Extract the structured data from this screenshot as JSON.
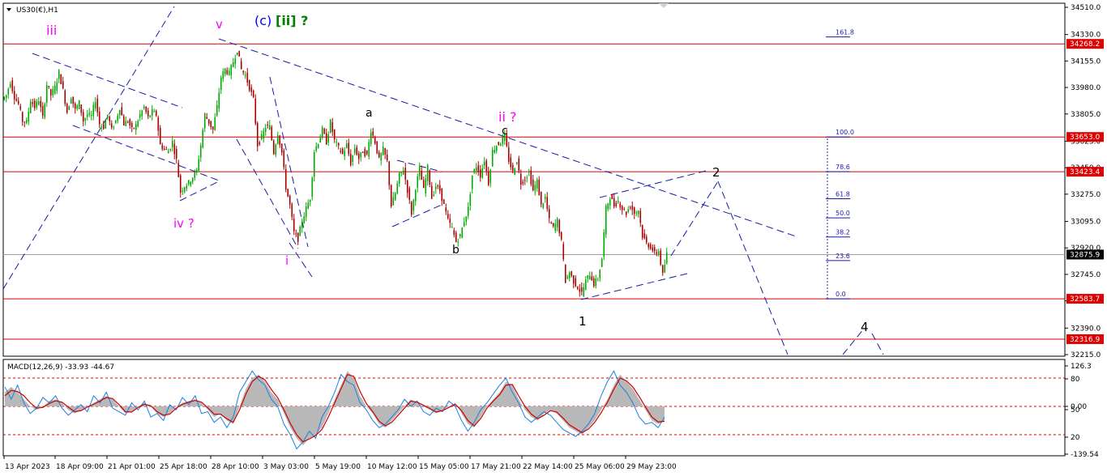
{
  "chart_header": {
    "symbol_label": "US30(€),H1",
    "macd_label": "MACD(12,26,9) -33.93 -44.67"
  },
  "colors": {
    "background": "#ffffff",
    "grid_border": "#000000",
    "bull_candle": "#00aa00",
    "bear_candle": "#aa0000",
    "resistance_line": "#dd0000",
    "trend_line": "#1a1aa8",
    "current_price_line": "#9e9e9e",
    "price_tag": "#dd0000",
    "current_price_tag": "#000000",
    "macd_hist": "#b8b8b8",
    "macd_signal": "#cc0000",
    "macd_line": "#1e7fe0",
    "wave_magenta": "#ff00ff",
    "wave_blue": "#0000ff",
    "wave_green": "#008000",
    "wave_black": "#000000"
  },
  "chart_data": [
    {
      "type": "candlestick",
      "symbol": "US30(€)",
      "timeframe": "H1",
      "ylim": [
        32110,
        34560
      ],
      "y_ticks": [
        34510.0,
        34330.0,
        34155.0,
        33980.0,
        33805.0,
        33625.0,
        33450.0,
        33275.0,
        33095.0,
        32920.0,
        32745.0,
        32570.0,
        32390.0,
        32215.0
      ],
      "x_tick_labels": [
        "13 Apr 2023",
        "18 Apr 09:00",
        "21 Apr 01:00",
        "25 Apr 18:00",
        "28 Apr 10:00",
        "3 May 03:00",
        "5 May 19:00",
        "10 May 12:00",
        "15 May 05:00",
        "17 May 21:00",
        "22 May 14:00",
        "25 May 06:00",
        "29 May 23:00"
      ],
      "horizontal_levels": [
        34268.2,
        33653.0,
        33423.4,
        32583.7,
        32316.9
      ],
      "current_price": 32875.9,
      "price_path": [
        [
          0,
          33900
        ],
        [
          5,
          33930
        ],
        [
          10,
          34020
        ],
        [
          15,
          33920
        ],
        [
          20,
          33870
        ],
        [
          25,
          33760
        ],
        [
          30,
          33750
        ],
        [
          35,
          33900
        ],
        [
          40,
          33850
        ],
        [
          45,
          33900
        ],
        [
          50,
          33780
        ],
        [
          55,
          34000
        ],
        [
          60,
          33930
        ],
        [
          65,
          33980
        ],
        [
          70,
          34080
        ],
        [
          75,
          33960
        ],
        [
          80,
          33820
        ],
        [
          85,
          33920
        ],
        [
          90,
          33830
        ],
        [
          95,
          33880
        ],
        [
          100,
          33760
        ],
        [
          105,
          33800
        ],
        [
          110,
          33790
        ],
        [
          115,
          33900
        ],
        [
          120,
          33740
        ],
        [
          125,
          33720
        ],
        [
          130,
          33800
        ],
        [
          135,
          33700
        ],
        [
          140,
          33760
        ],
        [
          145,
          33850
        ],
        [
          150,
          33740
        ],
        [
          155,
          33760
        ],
        [
          160,
          33700
        ],
        [
          165,
          33730
        ],
        [
          170,
          33800
        ],
        [
          175,
          33850
        ],
        [
          180,
          33780
        ],
        [
          185,
          33820
        ],
        [
          190,
          33800
        ],
        [
          195,
          33600
        ],
        [
          200,
          33570
        ],
        [
          205,
          33560
        ],
        [
          210,
          33620
        ],
        [
          215,
          33500
        ],
        [
          220,
          33290
        ],
        [
          225,
          33330
        ],
        [
          230,
          33350
        ],
        [
          235,
          33390
        ],
        [
          240,
          33430
        ],
        [
          245,
          33600
        ],
        [
          250,
          33800
        ],
        [
          255,
          33750
        ],
        [
          260,
          33700
        ],
        [
          265,
          33850
        ],
        [
          270,
          34050
        ],
        [
          275,
          34100
        ],
        [
          280,
          34070
        ],
        [
          285,
          34150
        ],
        [
          290,
          34230
        ],
        [
          295,
          34100
        ],
        [
          300,
          34060
        ],
        [
          305,
          33980
        ],
        [
          310,
          33900
        ],
        [
          315,
          33600
        ],
        [
          320,
          33650
        ],
        [
          325,
          33720
        ],
        [
          330,
          33720
        ],
        [
          335,
          33550
        ],
        [
          340,
          33680
        ],
        [
          345,
          33550
        ],
        [
          350,
          33320
        ],
        [
          355,
          33200
        ],
        [
          360,
          33020
        ],
        [
          365,
          32980
        ],
        [
          370,
          33100
        ],
        [
          375,
          33180
        ],
        [
          380,
          33250
        ],
        [
          385,
          33560
        ],
        [
          390,
          33620
        ],
        [
          395,
          33700
        ],
        [
          400,
          33620
        ],
        [
          405,
          33750
        ],
        [
          410,
          33630
        ],
        [
          415,
          33580
        ],
        [
          420,
          33540
        ],
        [
          425,
          33600
        ],
        [
          430,
          33480
        ],
        [
          435,
          33580
        ],
        [
          440,
          33510
        ],
        [
          445,
          33560
        ],
        [
          450,
          33530
        ],
        [
          455,
          33700
        ],
        [
          460,
          33620
        ],
        [
          465,
          33500
        ],
        [
          470,
          33570
        ],
        [
          475,
          33490
        ],
        [
          480,
          33200
        ],
        [
          485,
          33280
        ],
        [
          490,
          33400
        ],
        [
          495,
          33440
        ],
        [
          500,
          33300
        ],
        [
          505,
          33150
        ],
        [
          510,
          33320
        ],
        [
          515,
          33440
        ],
        [
          520,
          33300
        ],
        [
          525,
          33450
        ],
        [
          530,
          33250
        ],
        [
          535,
          33330
        ],
        [
          540,
          33300
        ],
        [
          545,
          33200
        ],
        [
          550,
          33100
        ],
        [
          555,
          33050
        ],
        [
          560,
          32960
        ],
        [
          565,
          33000
        ],
        [
          570,
          33100
        ],
        [
          575,
          33180
        ],
        [
          580,
          33400
        ],
        [
          585,
          33460
        ],
        [
          590,
          33400
        ],
        [
          595,
          33500
        ],
        [
          600,
          33350
        ],
        [
          605,
          33560
        ],
        [
          610,
          33600
        ],
        [
          615,
          33620
        ],
        [
          620,
          33660
        ],
        [
          625,
          33500
        ],
        [
          630,
          33420
        ],
        [
          635,
          33500
        ],
        [
          640,
          33350
        ],
        [
          645,
          33380
        ],
        [
          650,
          33420
        ],
        [
          655,
          33300
        ],
        [
          660,
          33360
        ],
        [
          665,
          33200
        ],
        [
          670,
          33250
        ],
        [
          675,
          33100
        ],
        [
          680,
          33050
        ],
        [
          685,
          33100
        ],
        [
          690,
          32960
        ],
        [
          695,
          32700
        ],
        [
          700,
          32760
        ],
        [
          705,
          32700
        ],
        [
          710,
          32660
        ],
        [
          715,
          32620
        ],
        [
          720,
          32700
        ],
        [
          725,
          32750
        ],
        [
          730,
          32680
        ],
        [
          735,
          32720
        ],
        [
          740,
          32850
        ],
        [
          745,
          33180
        ],
        [
          750,
          33260
        ],
        [
          755,
          33200
        ],
        [
          760,
          33230
        ],
        [
          765,
          33180
        ],
        [
          770,
          33150
        ],
        [
          775,
          33200
        ],
        [
          780,
          33150
        ],
        [
          785,
          33170
        ],
        [
          790,
          33000
        ],
        [
          795,
          32950
        ],
        [
          800,
          32930
        ],
        [
          805,
          32880
        ],
        [
          810,
          32900
        ],
        [
          815,
          32740
        ],
        [
          820,
          32880
        ]
      ],
      "fibonacci": {
        "levels": [
          "0.0",
          "23.6",
          "38.2",
          "50.0",
          "61.8",
          "78.6",
          "100.0",
          "161.8"
        ]
      },
      "annotations": [
        {
          "text": "iii",
          "color": "magenta"
        },
        {
          "text": "v",
          "color": "magenta"
        },
        {
          "text": "(c)",
          "color": "blue"
        },
        {
          "text": "[ii] ?",
          "color": "green"
        },
        {
          "text": "iv ?",
          "color": "magenta"
        },
        {
          "text": "i",
          "color": "magenta"
        },
        {
          "text": "a",
          "color": "black"
        },
        {
          "text": "b",
          "color": "black"
        },
        {
          "text": "c",
          "color": "black"
        },
        {
          "text": "ii ?",
          "color": "magenta"
        },
        {
          "text": "1",
          "color": "black"
        },
        {
          "text": "2",
          "color": "black"
        },
        {
          "text": "4",
          "color": "black"
        }
      ]
    },
    {
      "type": "macd",
      "name": "MACD(12,26,9)",
      "y_ticks": [
        "126.3",
        "80",
        "0.00",
        "50",
        "20",
        "-139.54"
      ],
      "dashed_levels": [
        80,
        0,
        -80
      ],
      "histogram": [
        40,
        55,
        40,
        20,
        0,
        -10,
        0,
        15,
        20,
        10,
        -10,
        -20,
        -10,
        0,
        10,
        20,
        30,
        20,
        0,
        -20,
        -15,
        0,
        10,
        0,
        -20,
        -30,
        -20,
        0,
        10,
        15,
        20,
        10,
        -10,
        -30,
        -20,
        -40,
        -50,
        0,
        50,
        80,
        90,
        70,
        40,
        20,
        -20,
        -60,
        -90,
        -110,
        -90,
        -80,
        -60,
        -20,
        20,
        60,
        100,
        80,
        30,
        0,
        -20,
        -50,
        -60,
        -40,
        -20,
        0,
        20,
        10,
        0,
        -10,
        -20,
        -10,
        0,
        10,
        -20,
        -50,
        -60,
        -30,
        0,
        20,
        40,
        70,
        60,
        20,
        -10,
        -30,
        -40,
        -20,
        -10,
        -20,
        -40,
        -60,
        -70,
        -80,
        -60,
        -40,
        -10,
        20,
        60,
        90,
        70,
        50,
        20,
        -10,
        -40,
        -50,
        -40
      ],
      "signal": [
        30,
        45,
        42,
        30,
        10,
        -5,
        -3,
        8,
        16,
        12,
        -2,
        -15,
        -12,
        -2,
        6,
        15,
        25,
        22,
        5,
        -15,
        -16,
        -3,
        6,
        2,
        -15,
        -25,
        -22,
        -5,
        6,
        12,
        17,
        12,
        -4,
        -22,
        -22,
        -35,
        -45,
        -10,
        35,
        70,
        85,
        75,
        48,
        25,
        -10,
        -48,
        -80,
        -100,
        -92,
        -82,
        -65,
        -30,
        10,
        50,
        90,
        85,
        42,
        8,
        -15,
        -42,
        -55,
        -45,
        -25,
        -5,
        15,
        12,
        3,
        -6,
        -16,
        -12,
        -3,
        6,
        -12,
        -40,
        -55,
        -35,
        -5,
        15,
        33,
        60,
        62,
        30,
        0,
        -22,
        -35,
        -25,
        -12,
        -16,
        -33,
        -52,
        -63,
        -74,
        -64,
        -45,
        -18,
        12,
        48,
        80,
        72,
        55,
        28,
        -2,
        -30,
        -44,
        -42
      ],
      "macd": [
        55,
        20,
        60,
        10,
        -20,
        -5,
        25,
        10,
        30,
        -5,
        -25,
        -10,
        5,
        -15,
        30,
        10,
        40,
        -5,
        -15,
        -25,
        10,
        -10,
        15,
        -30,
        -20,
        -40,
        5,
        -10,
        25,
        5,
        30,
        -20,
        -15,
        -45,
        -30,
        -60,
        -30,
        40,
        70,
        100,
        75,
        60,
        20,
        0,
        -50,
        -80,
        -120,
        -100,
        -70,
        -90,
        -30,
        0,
        40,
        90,
        70,
        60,
        10,
        -10,
        -40,
        -60,
        -50,
        -30,
        -10,
        20,
        0,
        15,
        -15,
        -25,
        -5,
        -15,
        15,
        0,
        -40,
        -70,
        -45,
        -10,
        10,
        35,
        60,
        80,
        40,
        10,
        -30,
        -45,
        -30,
        -15,
        -25,
        -45,
        -65,
        -75,
        -85,
        -70,
        -50,
        -20,
        30,
        70,
        100,
        60,
        40,
        10,
        -30,
        -50,
        -45,
        -60,
        -30
      ]
    }
  ]
}
